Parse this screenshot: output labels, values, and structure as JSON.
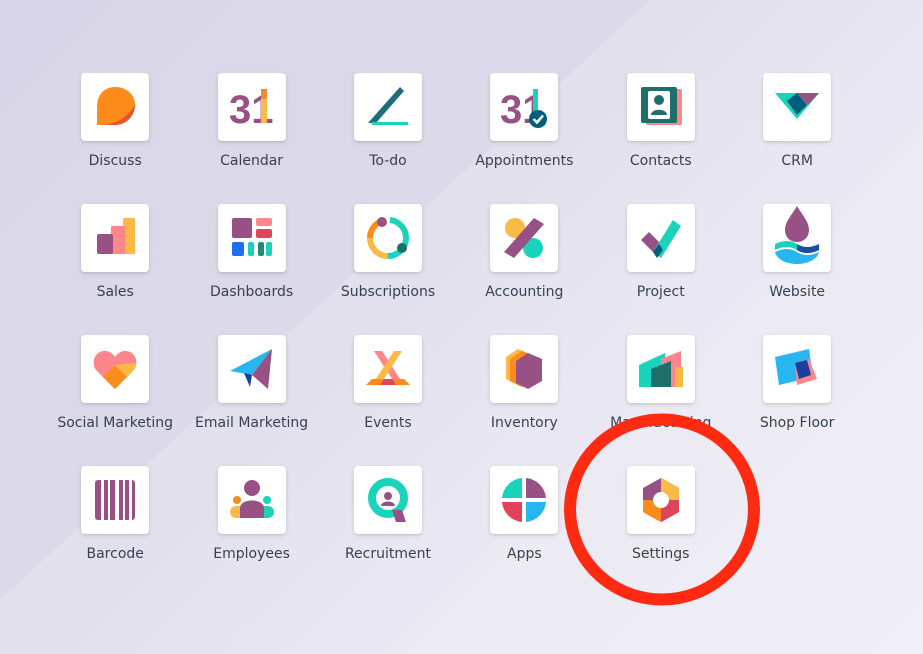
{
  "apps": [
    {
      "label": "Discuss",
      "icon": "discuss-icon"
    },
    {
      "label": "Calendar",
      "icon": "calendar-icon"
    },
    {
      "label": "To-do",
      "icon": "todo-icon"
    },
    {
      "label": "Appointments",
      "icon": "appointments-icon"
    },
    {
      "label": "Contacts",
      "icon": "contacts-icon"
    },
    {
      "label": "CRM",
      "icon": "crm-icon"
    },
    {
      "label": "Sales",
      "icon": "sales-icon"
    },
    {
      "label": "Dashboards",
      "icon": "dashboards-icon"
    },
    {
      "label": "Subscriptions",
      "icon": "subscriptions-icon"
    },
    {
      "label": "Accounting",
      "icon": "accounting-icon"
    },
    {
      "label": "Project",
      "icon": "project-icon"
    },
    {
      "label": "Website",
      "icon": "website-icon"
    },
    {
      "label": "Social Marketing",
      "icon": "social-marketing-icon"
    },
    {
      "label": "Email Marketing",
      "icon": "email-marketing-icon"
    },
    {
      "label": "Events",
      "icon": "events-icon"
    },
    {
      "label": "Inventory",
      "icon": "inventory-icon"
    },
    {
      "label": "Manufacturing",
      "icon": "manufacturing-icon"
    },
    {
      "label": "Shop Floor",
      "icon": "shop-floor-icon"
    },
    {
      "label": "Barcode",
      "icon": "barcode-icon"
    },
    {
      "label": "Employees",
      "icon": "employees-icon"
    },
    {
      "label": "Recruitment",
      "icon": "recruitment-icon"
    },
    {
      "label": "Apps",
      "icon": "apps-icon"
    },
    {
      "label": "Settings",
      "icon": "settings-icon"
    }
  ],
  "calendar_day": "31",
  "appointments_day": "31",
  "highlight": {
    "target": "Settings",
    "color": "#ff2a12"
  },
  "colors": {
    "purple": "#985184",
    "teal": "#1ad3bb",
    "orange": "#fc868b",
    "dark_teal": "#005e7a",
    "yellow": "#fbb945"
  }
}
